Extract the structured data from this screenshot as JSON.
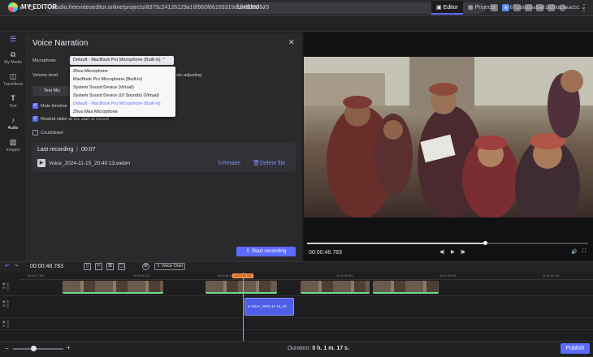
{
  "browser": {
    "url": "studio.freevideoeditor.online/projects/8375c24126129a16f960f66165315dbbe6390879"
  },
  "header": {
    "app_title": "MY EDITOR",
    "project_name": "Untitled",
    "tabs": [
      {
        "label": "Editor"
      },
      {
        "label": "Projects"
      }
    ],
    "account": "671a8cb3a5a81628d19eacb1"
  },
  "nav": {
    "items": [
      {
        "label": "My Media",
        "icon": "media-icon"
      },
      {
        "label": "Transitions",
        "icon": "transitions-icon"
      },
      {
        "label": "Text",
        "icon": "text-icon"
      },
      {
        "label": "Audio",
        "icon": "audio-icon"
      },
      {
        "label": "Images",
        "icon": "images-icon"
      }
    ]
  },
  "panel": {
    "title": "Voice Narration",
    "microphone_label": "Microphone",
    "microphone_value": "Default - MacBook Pro Microphone (Built-in)",
    "dropdown_options": [
      "Zhuu Microphone",
      "MacBook Pro Microphone (Built-in)",
      "System Sound Device (Virtual)",
      "System Sound Device (UI Sounds) (Virtual)",
      "Default - MacBook Pro Microphone (Built-in)",
      "Zhuu Max Microphone"
    ],
    "volume_label": "Volume level",
    "auto_adjust_fragment": "uto adjusting",
    "test_mic": "Test Mic",
    "mute_timeline": "Mute timeline",
    "rewind_slider": "Rewind slider at the start of record",
    "countdown": "Countdown",
    "last_recording_label": "Last recording",
    "last_recording_duration": "00:07",
    "recording_file": "Voice_2024-11-15_20:40:13.webm",
    "retake": "Retake",
    "delete_file": "Delete file",
    "start_recording": "Start recording"
  },
  "preview": {
    "time": "00:00:48.783",
    "progress": 0.64
  },
  "timeline": {
    "current_time": "00:00:48.783",
    "voice_over": "Voice Over",
    "playhead_label": "00:00:48.783",
    "ruler_ticks": [
      "00:00:17.321",
      "00:00:34.222",
      "00:00:51.823",
      "00:01:08.431",
      "00:01:25.323",
      "00:01:42.223"
    ],
    "audio_clip_label": "Voice_2024-11-15_20"
  },
  "footer": {
    "duration_label": "Duration:",
    "duration_value": "0 h. 1 m. 17 s.",
    "publish": "Publish"
  },
  "colors": {
    "accent": "#5b6bff",
    "playhead": "#ff8f3f",
    "clip_marker": "#6fdc8c"
  }
}
